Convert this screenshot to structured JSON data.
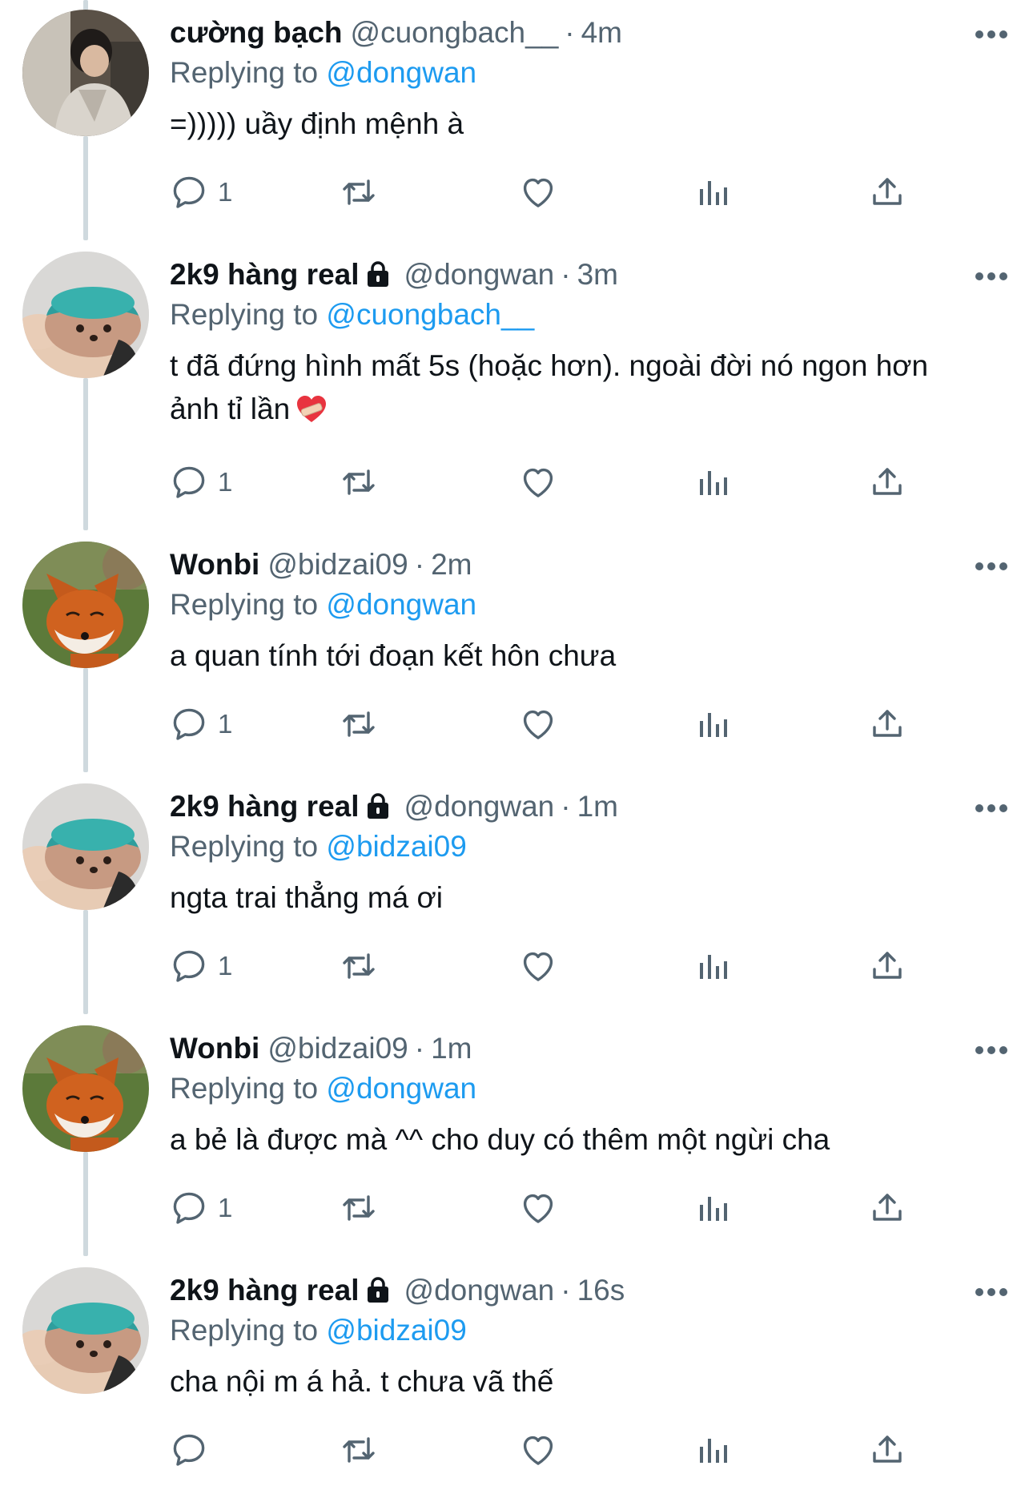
{
  "colors": {
    "link_blue": "#1d9bf0",
    "text_primary": "#0f1419",
    "text_secondary": "#536471",
    "thread_line": "#cfd9de"
  },
  "labels": {
    "replying_to": "Replying to",
    "separator": "·"
  },
  "tweets": [
    {
      "avatar": "avatar-person",
      "name": "cường bạch",
      "locked": false,
      "handle": "@cuongbach__",
      "time": "4m",
      "replying_to": "@dongwan",
      "text": "=))))) uầy định mệnh à",
      "reply_count": "1",
      "more_icon": "more-options-icon"
    },
    {
      "avatar": "avatar-toy",
      "name": "2k9 hàng real",
      "locked": true,
      "handle": "@dongwan",
      "time": "3m",
      "replying_to": "@cuongbach__",
      "text": "t đã đứng hình mất 5s (hoặc hơn). ngoài đời nó ngon hơn ảnh tỉ lần",
      "emoji": "heart-with-bandage-emoji",
      "reply_count": "1",
      "more_icon": "more-options-icon"
    },
    {
      "avatar": "avatar-fox",
      "name": "Wonbi",
      "locked": false,
      "handle": "@bidzai09",
      "time": "2m",
      "replying_to": "@dongwan",
      "text": "a quan tính tới đoạn kết hôn chưa",
      "reply_count": "1",
      "more_icon": "more-options-icon"
    },
    {
      "avatar": "avatar-toy",
      "name": "2k9 hàng real",
      "locked": true,
      "handle": "@dongwan",
      "time": "1m",
      "replying_to": "@bidzai09",
      "text": "ngta trai thẳng má ơi",
      "reply_count": "1",
      "more_icon": "more-options-icon"
    },
    {
      "avatar": "avatar-fox",
      "name": "Wonbi",
      "locked": false,
      "handle": "@bidzai09",
      "time": "1m",
      "replying_to": "@dongwan",
      "text": "a bẻ là được mà ^^ cho duy có thêm một ngừi cha",
      "reply_count": "1",
      "more_icon": "more-options-icon"
    },
    {
      "avatar": "avatar-toy",
      "name": "2k9 hàng real",
      "locked": true,
      "handle": "@dongwan",
      "time": "16s",
      "replying_to": "@bidzai09",
      "text": "cha nội m á hả. t chưa vã thế",
      "reply_count": "",
      "more_icon": "more-options-icon"
    }
  ]
}
